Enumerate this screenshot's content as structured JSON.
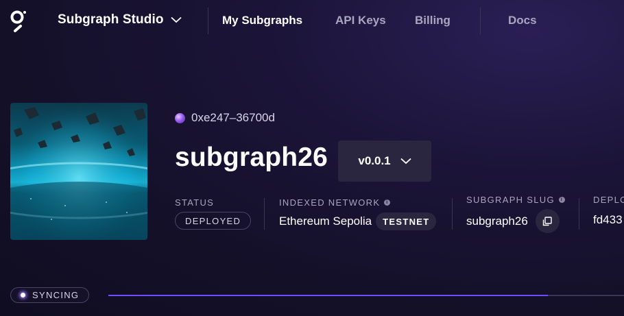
{
  "nav": {
    "studio_label": "Subgraph Studio",
    "links": [
      "My Subgraphs",
      "API Keys",
      "Billing",
      "Docs"
    ],
    "active": "My Subgraphs"
  },
  "subgraph": {
    "owner": "0xe247–36700d",
    "title": "subgraph26",
    "version": "v0.0.1"
  },
  "meta": {
    "status": {
      "label": "STATUS",
      "value": "DEPLOYED"
    },
    "network": {
      "label": "INDEXED NETWORK",
      "value": "Ethereum Sepolia",
      "badge": "TESTNET"
    },
    "slug": {
      "label": "SUBGRAPH SLUG",
      "value": "subgraph26"
    },
    "deployment": {
      "label": "DEPLO",
      "value": "fd433"
    }
  },
  "sync": {
    "label": "SYNCING",
    "progress": 0.853
  },
  "colors": {
    "accent": "#6f4cff",
    "background": "#1b1438",
    "muted_text": "#aaa6bf"
  },
  "icons": {
    "logo": "the-graph-logo-icon",
    "studio_chevron": "chevron-down-icon",
    "version_chevron": "chevron-down-icon",
    "info": "info-icon",
    "copy": "copy-icon",
    "owner_avatar": "avatar-icon"
  }
}
